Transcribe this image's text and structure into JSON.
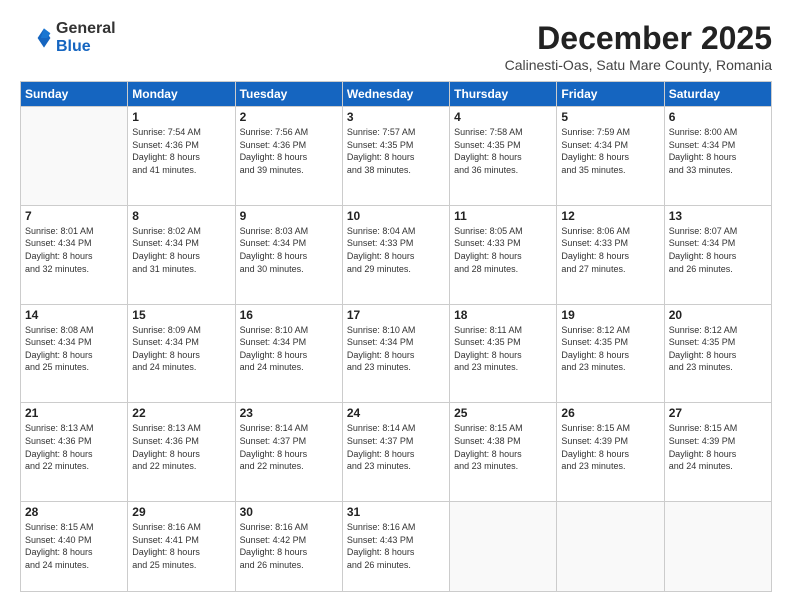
{
  "logo": {
    "line1": "General",
    "line2": "Blue"
  },
  "header": {
    "month": "December 2025",
    "location": "Calinesti-Oas, Satu Mare County, Romania"
  },
  "days": [
    "Sunday",
    "Monday",
    "Tuesday",
    "Wednesday",
    "Thursday",
    "Friday",
    "Saturday"
  ],
  "weeks": [
    [
      {
        "day": "",
        "info": ""
      },
      {
        "day": "1",
        "info": "Sunrise: 7:54 AM\nSunset: 4:36 PM\nDaylight: 8 hours\nand 41 minutes."
      },
      {
        "day": "2",
        "info": "Sunrise: 7:56 AM\nSunset: 4:36 PM\nDaylight: 8 hours\nand 39 minutes."
      },
      {
        "day": "3",
        "info": "Sunrise: 7:57 AM\nSunset: 4:35 PM\nDaylight: 8 hours\nand 38 minutes."
      },
      {
        "day": "4",
        "info": "Sunrise: 7:58 AM\nSunset: 4:35 PM\nDaylight: 8 hours\nand 36 minutes."
      },
      {
        "day": "5",
        "info": "Sunrise: 7:59 AM\nSunset: 4:34 PM\nDaylight: 8 hours\nand 35 minutes."
      },
      {
        "day": "6",
        "info": "Sunrise: 8:00 AM\nSunset: 4:34 PM\nDaylight: 8 hours\nand 33 minutes."
      }
    ],
    [
      {
        "day": "7",
        "info": "Sunrise: 8:01 AM\nSunset: 4:34 PM\nDaylight: 8 hours\nand 32 minutes."
      },
      {
        "day": "8",
        "info": "Sunrise: 8:02 AM\nSunset: 4:34 PM\nDaylight: 8 hours\nand 31 minutes."
      },
      {
        "day": "9",
        "info": "Sunrise: 8:03 AM\nSunset: 4:34 PM\nDaylight: 8 hours\nand 30 minutes."
      },
      {
        "day": "10",
        "info": "Sunrise: 8:04 AM\nSunset: 4:33 PM\nDaylight: 8 hours\nand 29 minutes."
      },
      {
        "day": "11",
        "info": "Sunrise: 8:05 AM\nSunset: 4:33 PM\nDaylight: 8 hours\nand 28 minutes."
      },
      {
        "day": "12",
        "info": "Sunrise: 8:06 AM\nSunset: 4:33 PM\nDaylight: 8 hours\nand 27 minutes."
      },
      {
        "day": "13",
        "info": "Sunrise: 8:07 AM\nSunset: 4:34 PM\nDaylight: 8 hours\nand 26 minutes."
      }
    ],
    [
      {
        "day": "14",
        "info": "Sunrise: 8:08 AM\nSunset: 4:34 PM\nDaylight: 8 hours\nand 25 minutes."
      },
      {
        "day": "15",
        "info": "Sunrise: 8:09 AM\nSunset: 4:34 PM\nDaylight: 8 hours\nand 24 minutes."
      },
      {
        "day": "16",
        "info": "Sunrise: 8:10 AM\nSunset: 4:34 PM\nDaylight: 8 hours\nand 24 minutes."
      },
      {
        "day": "17",
        "info": "Sunrise: 8:10 AM\nSunset: 4:34 PM\nDaylight: 8 hours\nand 23 minutes."
      },
      {
        "day": "18",
        "info": "Sunrise: 8:11 AM\nSunset: 4:35 PM\nDaylight: 8 hours\nand 23 minutes."
      },
      {
        "day": "19",
        "info": "Sunrise: 8:12 AM\nSunset: 4:35 PM\nDaylight: 8 hours\nand 23 minutes."
      },
      {
        "day": "20",
        "info": "Sunrise: 8:12 AM\nSunset: 4:35 PM\nDaylight: 8 hours\nand 23 minutes."
      }
    ],
    [
      {
        "day": "21",
        "info": "Sunrise: 8:13 AM\nSunset: 4:36 PM\nDaylight: 8 hours\nand 22 minutes."
      },
      {
        "day": "22",
        "info": "Sunrise: 8:13 AM\nSunset: 4:36 PM\nDaylight: 8 hours\nand 22 minutes."
      },
      {
        "day": "23",
        "info": "Sunrise: 8:14 AM\nSunset: 4:37 PM\nDaylight: 8 hours\nand 22 minutes."
      },
      {
        "day": "24",
        "info": "Sunrise: 8:14 AM\nSunset: 4:37 PM\nDaylight: 8 hours\nand 23 minutes."
      },
      {
        "day": "25",
        "info": "Sunrise: 8:15 AM\nSunset: 4:38 PM\nDaylight: 8 hours\nand 23 minutes."
      },
      {
        "day": "26",
        "info": "Sunrise: 8:15 AM\nSunset: 4:39 PM\nDaylight: 8 hours\nand 23 minutes."
      },
      {
        "day": "27",
        "info": "Sunrise: 8:15 AM\nSunset: 4:39 PM\nDaylight: 8 hours\nand 24 minutes."
      }
    ],
    [
      {
        "day": "28",
        "info": "Sunrise: 8:15 AM\nSunset: 4:40 PM\nDaylight: 8 hours\nand 24 minutes."
      },
      {
        "day": "29",
        "info": "Sunrise: 8:16 AM\nSunset: 4:41 PM\nDaylight: 8 hours\nand 25 minutes."
      },
      {
        "day": "30",
        "info": "Sunrise: 8:16 AM\nSunset: 4:42 PM\nDaylight: 8 hours\nand 26 minutes."
      },
      {
        "day": "31",
        "info": "Sunrise: 8:16 AM\nSunset: 4:43 PM\nDaylight: 8 hours\nand 26 minutes."
      },
      {
        "day": "",
        "info": ""
      },
      {
        "day": "",
        "info": ""
      },
      {
        "day": "",
        "info": ""
      }
    ]
  ]
}
